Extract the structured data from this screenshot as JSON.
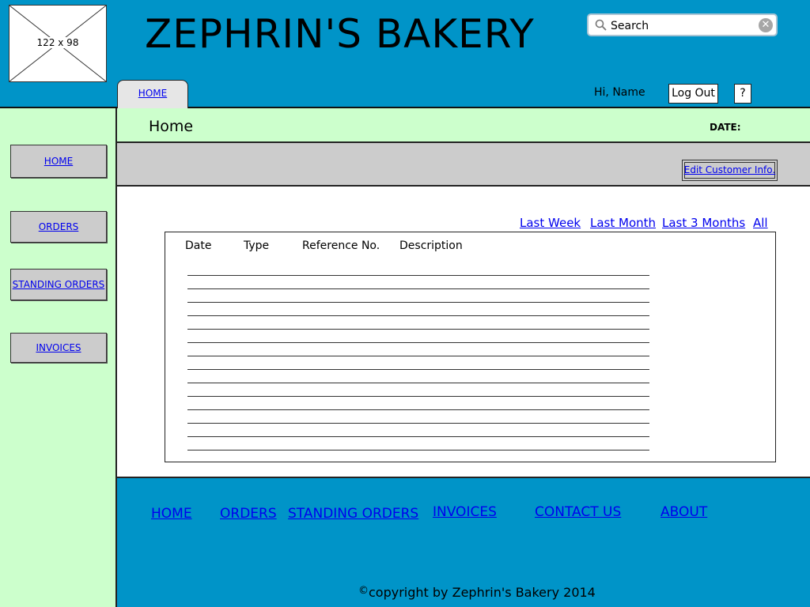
{
  "header": {
    "logo_placeholder": "122 x 98",
    "site_title": "ZEPHRIN'S BAKERY",
    "search": {
      "placeholder": "Search",
      "value": ""
    },
    "tab_home": "HOME",
    "greeting": "Hi, Name",
    "logout_label": "Log Out",
    "help_label": "?"
  },
  "sidebar": {
    "items": [
      {
        "label": "HOME"
      },
      {
        "label": "ORDERS"
      },
      {
        "label": "STANDING ORDERS"
      },
      {
        "label": "INVOICES"
      }
    ]
  },
  "subheader": {
    "page_title": "Home",
    "date_label": "DATE:"
  },
  "toolbar": {
    "edit_label": "Edit Customer Info."
  },
  "filters": [
    "Last Week",
    "Last Month",
    "Last 3 Months",
    "All"
  ],
  "table": {
    "columns": [
      "Date",
      "Type",
      "Reference No.",
      "Description"
    ],
    "row_count": 14
  },
  "footer": {
    "links": [
      "HOME",
      "ORDERS",
      "STANDING ORDERS",
      "INVOICES",
      "CONTACT US",
      "ABOUT"
    ],
    "copyright_symbol": "©",
    "copyright_text": "copyright by Zephrin's Bakery 2014"
  },
  "colors": {
    "header_bg": "#0094c8",
    "sidebar_bg": "#ccffcc",
    "button_bg": "#cccccc",
    "link": "#0000ee"
  }
}
